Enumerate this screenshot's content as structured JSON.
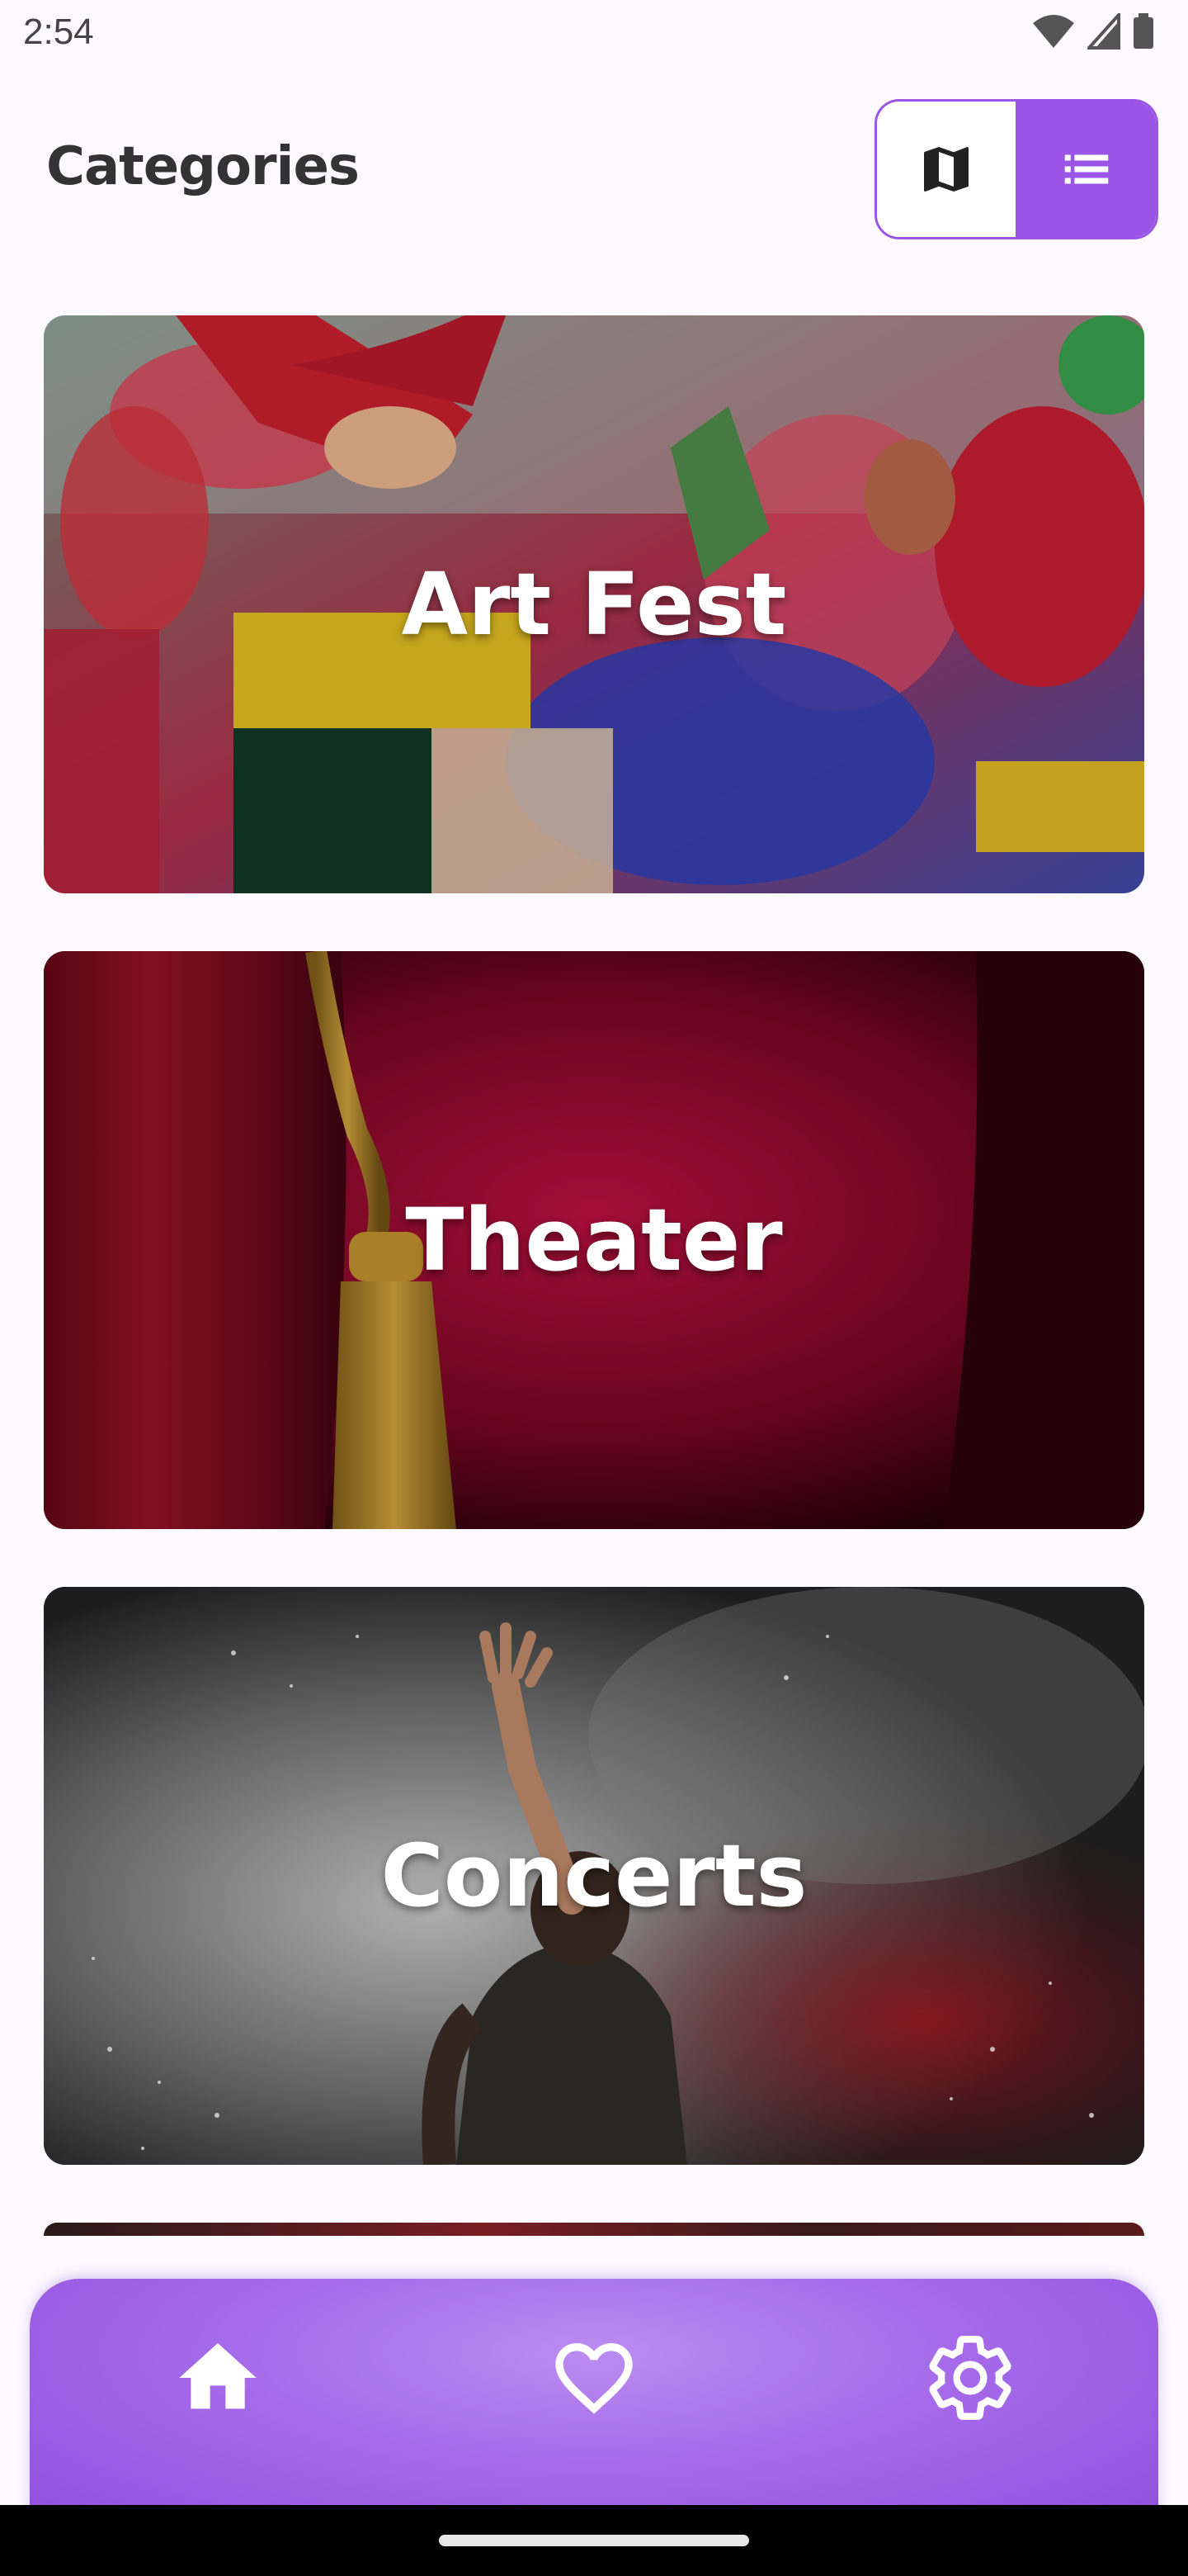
{
  "status_bar": {
    "time": "2:54",
    "icons": [
      "wifi-icon",
      "cellular-signal-icon",
      "battery-icon"
    ]
  },
  "header": {
    "title": "Categories",
    "view_toggle": {
      "options": [
        "map-view-icon",
        "list-view-icon"
      ],
      "selected": "list",
      "accent_color": "#9a55e6"
    }
  },
  "categories": [
    {
      "label": "Art Fest"
    },
    {
      "label": "Theater"
    },
    {
      "label": "Concerts"
    }
  ],
  "bottom_nav": {
    "items": [
      "home-icon",
      "heart-icon",
      "settings-gear-icon"
    ],
    "color": "#a56bea"
  }
}
